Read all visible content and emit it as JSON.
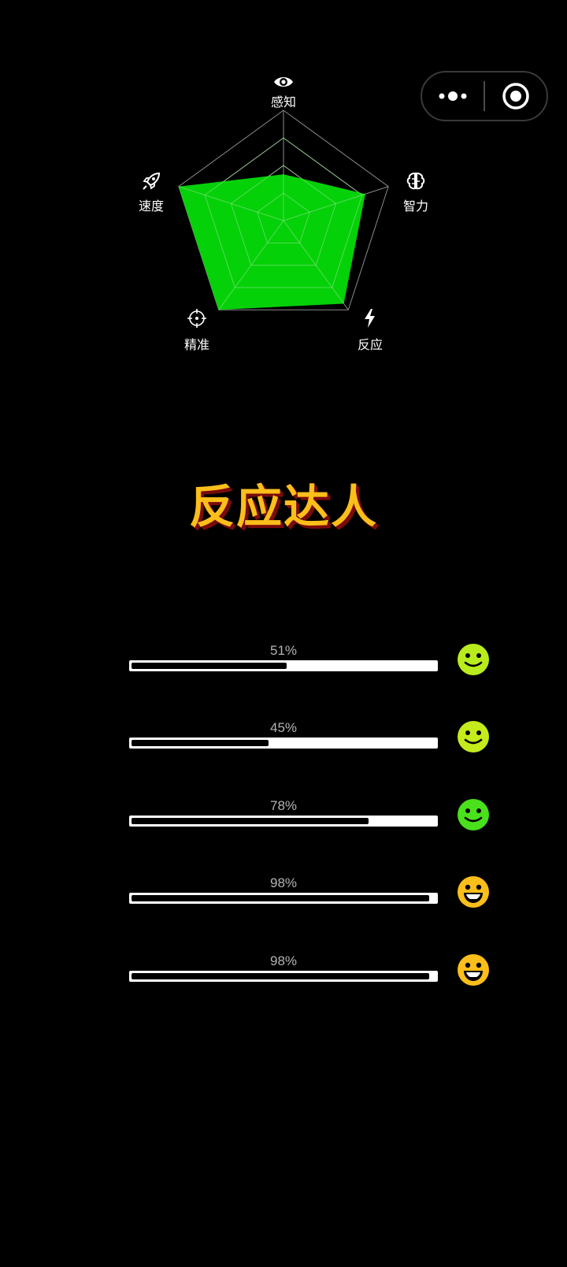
{
  "capsule": {
    "more_icon": "more-dots-icon",
    "close_icon": "record-circle-icon"
  },
  "radar": {
    "axes": [
      {
        "label": "感知",
        "icon": "eye-icon",
        "value": 0.42
      },
      {
        "label": "智力",
        "icon": "brain-icon",
        "value": 0.78
      },
      {
        "label": "反应",
        "icon": "lightning-icon",
        "value": 0.93
      },
      {
        "label": "精准",
        "icon": "crosshair-icon",
        "value": 1.0
      },
      {
        "label": "速度",
        "icon": "rocket-icon",
        "value": 1.0
      }
    ],
    "fill_color": "#05d108",
    "grid_color": "#8a8a8a",
    "levels": 4
  },
  "title": "反应达人",
  "title_color": "#fcbe1a",
  "stats": [
    {
      "percent": "51%",
      "value": 0.51,
      "face": "smile-icon",
      "color": "#b9ec1c"
    },
    {
      "percent": "45%",
      "value": 0.45,
      "face": "smile-icon",
      "color": "#c4ec1c"
    },
    {
      "percent": "78%",
      "value": 0.78,
      "face": "smile-icon",
      "color": "#4ae01c"
    },
    {
      "percent": "98%",
      "value": 0.98,
      "face": "grin-icon",
      "color": "#fcbe1a"
    },
    {
      "percent": "98%",
      "value": 0.98,
      "face": "grin-icon",
      "color": "#fcbe1a"
    }
  ]
}
